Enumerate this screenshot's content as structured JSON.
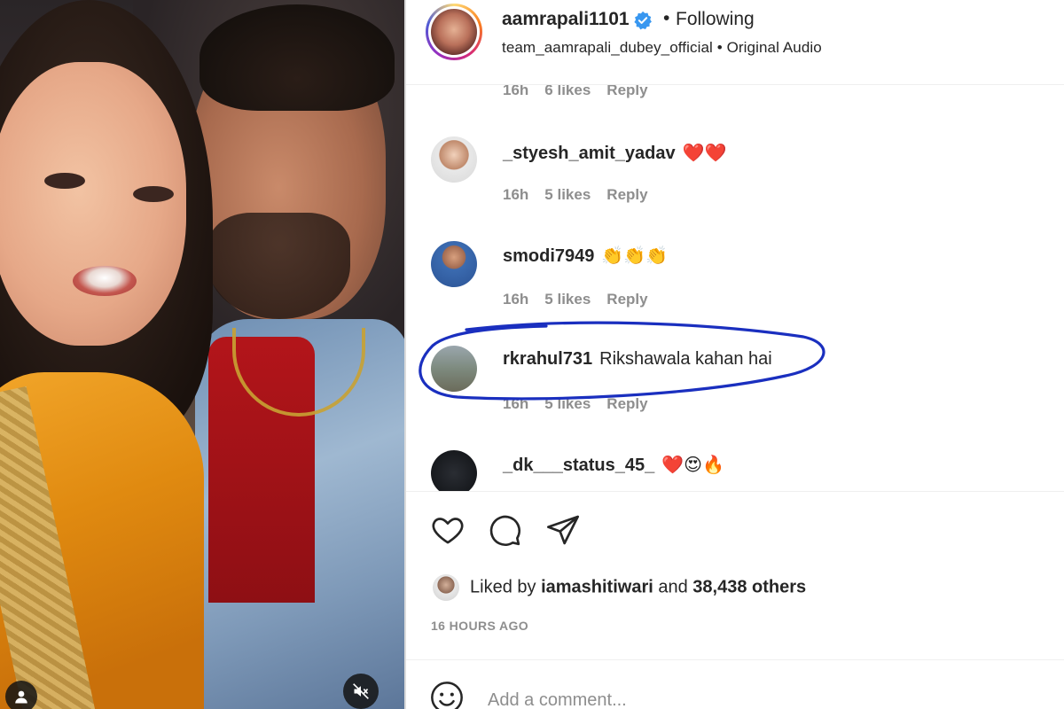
{
  "post": {
    "username": "aamrapali1101",
    "follow_status": "Following",
    "separator": "•",
    "audio_line": "team_aamrapali_dubey_official • Original Audio"
  },
  "comments": [
    {
      "time": "16h",
      "likes": "6 likes",
      "reply": "Reply"
    },
    {
      "username": "_styesh_amit_yadav",
      "text": "❤️❤️",
      "time": "16h",
      "likes": "5 likes",
      "reply": "Reply"
    },
    {
      "username": "smodi7949",
      "text": "👏👏👏",
      "time": "16h",
      "likes": "5 likes",
      "reply": "Reply"
    },
    {
      "username": "rkrahul731",
      "text": "Rikshawala kahan hai",
      "time": "16h",
      "likes": "5 likes",
      "reply": "Reply"
    },
    {
      "username": "_dk___status_45_",
      "text": "❤️😍🔥"
    }
  ],
  "likes": {
    "prefix": "Liked by",
    "user": "iamashitiwari",
    "connector": "and",
    "others": "38,438 others"
  },
  "time_ago": "16 HOURS AGO",
  "add_comment": {
    "placeholder": "Add a comment..."
  },
  "icons": [
    "heart-icon",
    "comment-icon",
    "share-icon",
    "emoji-icon",
    "user-tag-icon",
    "mute-icon",
    "verified-badge-icon"
  ],
  "colors": {
    "verified": "#3897f0",
    "annotation": "#1a2fbf",
    "meta_gray": "#8e8e8e"
  }
}
